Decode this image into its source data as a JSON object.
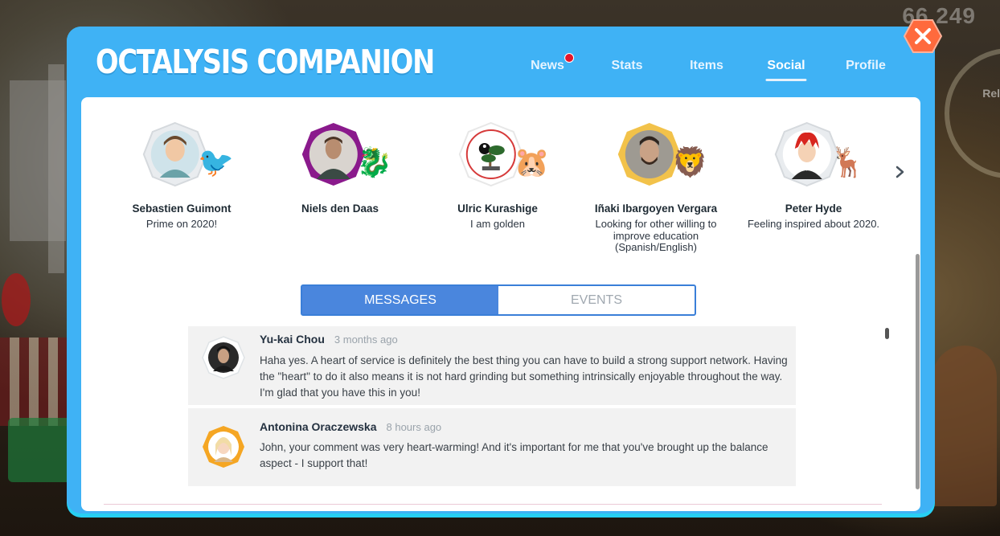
{
  "score": "66,249",
  "side_label": "Rel",
  "app": {
    "title": "OCTALYSIS COMPANION"
  },
  "nav": {
    "tabs": [
      {
        "label": "News",
        "notification": true
      },
      {
        "label": "Stats"
      },
      {
        "label": "Items"
      },
      {
        "label": "Social",
        "active": true
      },
      {
        "label": "Profile"
      }
    ]
  },
  "friends": [
    {
      "name": "Sebastien Guimont",
      "status": "Prime on 2020!",
      "pet": "🐦",
      "frame_color": "#e9ecef"
    },
    {
      "name": "Niels den Daas",
      "status": "",
      "pet": "🐉",
      "frame_color": "#8a1a8c"
    },
    {
      "name": "Ulric Kurashige",
      "status": "I am golden",
      "pet": "🐹",
      "frame_color": "#ffffff"
    },
    {
      "name": "Iñaki Ibargoyen Vergara",
      "status": "Looking for other willing to improve education (Spanish/English)",
      "pet": "🦁",
      "frame_color": "#f2c24a"
    },
    {
      "name": "Peter Hyde",
      "status": "Feeling inspired about 2020.",
      "pet": "🦌",
      "frame_color": "#e9ecef"
    }
  ],
  "segments": {
    "messages": "MESSAGES",
    "events": "EVENTS"
  },
  "messages": [
    {
      "author": "Yu-kai Chou",
      "time": "3 months ago",
      "text": "Haha yes. A heart of service is definitely the best thing you can have to build a strong support network. Having the \"heart\" to do it also means it is not hard grinding but something intrinsically enjoyable throughout the way. I'm glad that you have this in you!"
    },
    {
      "author": "Antonina Oraczewska",
      "time": "8 hours ago",
      "text": "John, your comment was very heart-warming! And it's important for me that you've brought up the balance aspect - I support that!"
    }
  ],
  "colors": {
    "modal_blue": "#3fb2f5",
    "modal_cyan": "#27cff3",
    "close_orange": "#ff6a3d",
    "segment_blue": "#4a86dd",
    "notification_red": "#e5152a"
  }
}
